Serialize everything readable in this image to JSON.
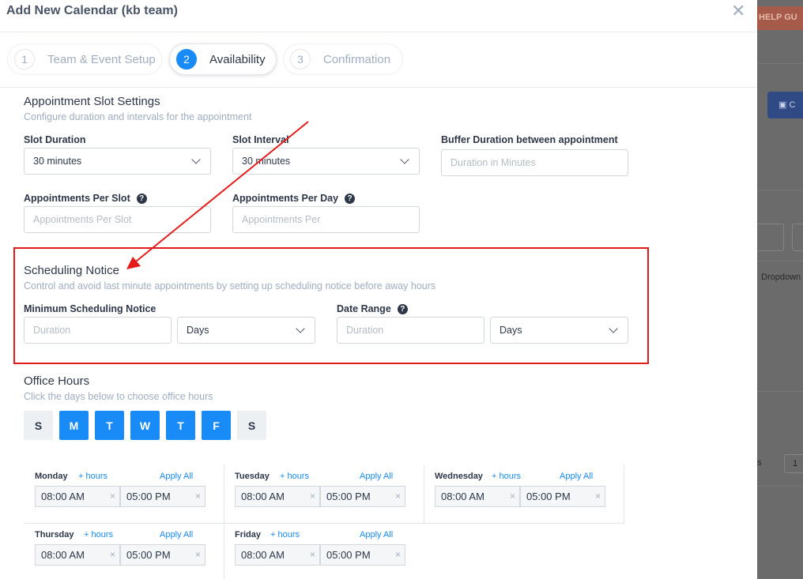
{
  "modal": {
    "title": "Add New Calendar (kb team)",
    "close_icon": "close-icon"
  },
  "steps": [
    {
      "num": "1",
      "label": "Team & Event Setup",
      "active": false
    },
    {
      "num": "2",
      "label": "Availability",
      "active": true
    },
    {
      "num": "3",
      "label": "Confirmation",
      "active": false
    }
  ],
  "slot_settings": {
    "title": "Appointment Slot Settings",
    "subtitle": "Configure duration and intervals for the appointment",
    "slot_duration": {
      "label": "Slot Duration",
      "value": "30 minutes"
    },
    "slot_interval": {
      "label": "Slot Interval",
      "value": "30 minutes"
    },
    "buffer": {
      "label": "Buffer Duration between appointment",
      "placeholder": "Duration in Minutes"
    },
    "per_slot": {
      "label": "Appointments Per Slot",
      "placeholder": "Appointments Per Slot"
    },
    "per_day": {
      "label": "Appointments Per Day",
      "placeholder": "Appointments Per"
    }
  },
  "scheduling_notice": {
    "title": "Scheduling Notice",
    "subtitle": "Control and avoid last minute appointments by setting up scheduling notice before away hours",
    "min_notice": {
      "label": "Minimum Scheduling Notice",
      "placeholder": "Duration",
      "unit": "Days"
    },
    "date_range": {
      "label": "Date Range",
      "placeholder": "Duration",
      "unit": "Days"
    }
  },
  "office_hours": {
    "title": "Office Hours",
    "subtitle": "Click the days below to choose office hours",
    "days": [
      {
        "letter": "S",
        "on": false
      },
      {
        "letter": "M",
        "on": true
      },
      {
        "letter": "T",
        "on": true
      },
      {
        "letter": "W",
        "on": true
      },
      {
        "letter": "T",
        "on": true
      },
      {
        "letter": "F",
        "on": true
      },
      {
        "letter": "S",
        "on": false
      }
    ],
    "plus_hours": "+ hours",
    "apply_all": "Apply All",
    "schedule": [
      {
        "day": "Monday",
        "start": "08:00 AM",
        "end": "05:00 PM"
      },
      {
        "day": "Tuesday",
        "start": "08:00 AM",
        "end": "05:00 PM"
      },
      {
        "day": "Wednesday",
        "start": "08:00 AM",
        "end": "05:00 PM"
      },
      {
        "day": "Thursday",
        "start": "08:00 AM",
        "end": "05:00 PM"
      },
      {
        "day": "Friday",
        "start": "08:00 AM",
        "end": "05:00 PM"
      }
    ],
    "clear_glyph": "×"
  },
  "background": {
    "help_text": "HELP GU",
    "button_text": "C",
    "dropdown_text": "Dropdown",
    "fragment_text": "s",
    "page_num": "1"
  },
  "colors": {
    "accent": "#188bf6",
    "annotation": "#e41b1b"
  }
}
